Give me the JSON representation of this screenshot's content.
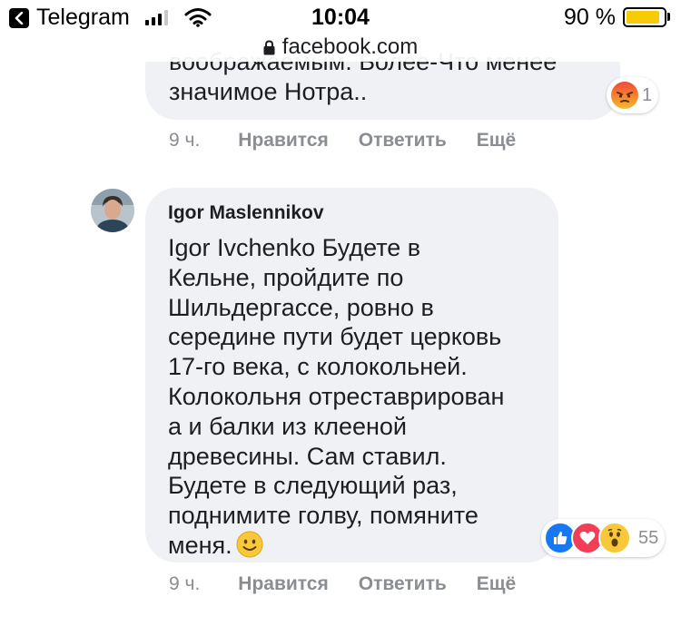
{
  "status_bar": {
    "back_app": "Telegram",
    "time": "10:04",
    "battery_percent": "90 %",
    "battery_level": 0.9,
    "signal_bars_active": 3,
    "signal_bars_total": 4
  },
  "browser": {
    "url": "facebook.com"
  },
  "comment_1": {
    "clipped_line": "воображаемым. Более-Что менее",
    "text_line": "значимое Нотра..",
    "reactions": {
      "icons": [
        "angry-face-icon"
      ],
      "count": "1"
    },
    "time": "9 ч.",
    "actions": [
      "Нравится",
      "Ответить",
      "Ещё"
    ]
  },
  "comment_2": {
    "author": "Igor Maslennikov",
    "body": "Igor Ivchenko Будете в\nКельне, пройдите по\nШильдергассе, ровно в\nсередине пути будет церковь\n17-го века, с колокольней.\nКолокольня отреставрирован\nа и балки из клееной\nдревесины. Сам ставил.\nБудете в следующий раз,\nподнимите голву, помяните\nменя.",
    "emoji": "smiling-face-icon",
    "reactions": {
      "icons": [
        "like-icon",
        "love-icon",
        "wow-icon"
      ],
      "count": "55"
    },
    "time": "9 ч.",
    "actions": [
      "Нравится",
      "Ответить",
      "Ещё"
    ]
  },
  "colors": {
    "bubble": "#f0f1f4",
    "meta_text": "#8a8d91",
    "like_blue": "#1877f2",
    "love_red": "#f33e58",
    "emoji_yellow": "#f7b928",
    "battery_yellow": "#f7cb05"
  }
}
